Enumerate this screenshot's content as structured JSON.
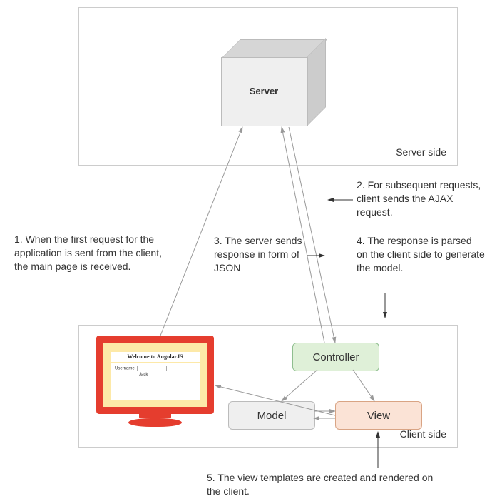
{
  "server_panel_label": "Server side",
  "client_panel_label": "Client side",
  "server_box_label": "Server",
  "controller_label": "Controller",
  "model_label": "Model",
  "view_label": "View",
  "monitor": {
    "title": "Welcome to AngularJS",
    "field_label": "Username:",
    "field_value": "Jack",
    "echo": "Jack"
  },
  "notes": {
    "n1": "1.  When the first request for the application is sent from the client, the main page is received.",
    "n2": "2. For subsequent requests, client sends the AJAX request.",
    "n3": "3. The server sends response in form of JSON",
    "n4": "4. The response is parsed on the client side to generate the model.",
    "n5": "5.  The view templates are created and rendered on the client."
  }
}
